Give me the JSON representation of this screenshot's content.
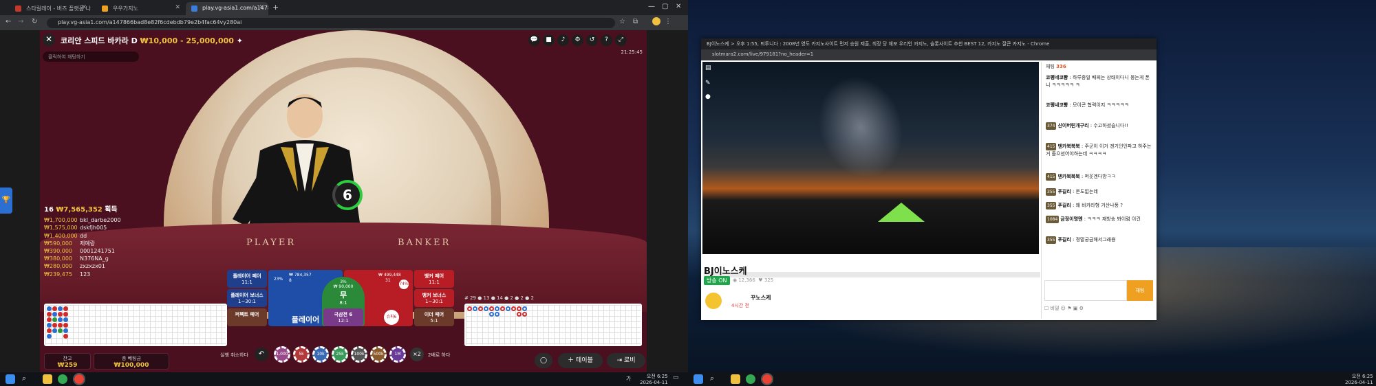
{
  "browser": {
    "tabs": [
      {
        "title": "스타릴레이 - 버즈 플랫폼 나디",
        "active": false,
        "color": "#c0392b"
      },
      {
        "title": "우우가지노",
        "active": false,
        "color": "#f0a020"
      },
      {
        "title": "play.vg-asia1.com/a1478",
        "active": true,
        "color": "#3b7ddd"
      }
    ],
    "new_tab": "+",
    "url": "play.vg-asia1.com/a147866bad8e82f6cdebdb79e2b4fac64vy280ai"
  },
  "game": {
    "close": "✕",
    "title": "코리안 스피드 바카라 D",
    "limit": "₩10,000 - 25,000,000",
    "chat_placeholder": "클릭하여 채팅하기",
    "clock": "21:25:45",
    "timer": "6",
    "table_player": "PLAYER",
    "table_banker": "BANKER",
    "players_count": "16",
    "players_total": "₩7,565,352",
    "players_total_suffix": "획득",
    "winners": [
      {
        "amount": "₩1,700,000",
        "name": "bkl_darbe2000"
      },
      {
        "amount": "₩1,575,000",
        "name": "dskfjh005"
      },
      {
        "amount": "₩1,400,000",
        "name": "dd"
      },
      {
        "amount": "₩590,000",
        "name": "제예랑"
      },
      {
        "amount": "₩390,000",
        "name": "0001241751"
      },
      {
        "amount": "₩380,000",
        "name": "N376NA_g"
      },
      {
        "amount": "₩280,000",
        "name": "zxzxzx01"
      },
      {
        "amount": "₩239,475",
        "name": "123"
      }
    ],
    "bets": {
      "player_pair": "플레이어 페어",
      "player_pair_odds": "11:1",
      "player_bonus": "플레이어 보너스",
      "player_bonus_odds": "1~30:1",
      "perfect_pair": "퍼펙트 페어",
      "player": "플레이어",
      "player_pct": "23%",
      "player_amt": "₩ 784,357",
      "player_count": "8",
      "tie": "무",
      "tie_odds": "8:1",
      "tie_pct": "3%",
      "tie_amt": "₩ 90,000",
      "banker_pct": "74%",
      "banker_amt": "₩ 499,448",
      "banker_count": "31",
      "banker_pair": "뱅커 페어",
      "banker_pair_odds": "11:1",
      "banker_bonus": "뱅커 보너스",
      "banker_bonus_odds": "1~30:1",
      "either_pair": "이더 페어",
      "either_pair_odds": "5:1",
      "super6": "슈퍼6",
      "lucky6": "극삼전 6",
      "lucky6_odds": "12:1"
    },
    "stats": "# 29  ● 13  ● 14  ● 2  ● 2  ● 2",
    "balance_label": "잔고",
    "balance": "₩259",
    "total_bet_label": "총 베팅금",
    "total_bet": "₩100,000",
    "undo_label": "실행 취소하다",
    "chips": [
      "1,000",
      "5k",
      "10k",
      "25k",
      "100k",
      "500k",
      "1M"
    ],
    "double": "×2",
    "double_label": "2배로 하다",
    "table_btn": "테이블",
    "lobby_btn": "로비"
  },
  "taskbar_left": {
    "time": "오전 6:25",
    "date": "2026-04-11",
    "lang": "가"
  },
  "stream": {
    "window_title": "BJ이노스케 > 오후 1:55, 퇴투니다 : 2008년 영도 카지노사이트 먼저 승원 제출, 최장 당 체포 우리언 카지노, 슬롯사이트 추천 BEST 12, 카지노 잘큰 카지노 - Chrome",
    "url": "slotmara2.com/live/979181?no_header=1",
    "streamer": "BJ이노스케",
    "on_air": "방송 ON",
    "viewers": "12,366",
    "fans": "325",
    "profile_name": "꾸노스케",
    "profile_time": "4시간 전",
    "chat_title": "채팅",
    "chat_count": "336",
    "messages": [
      {
        "user": "코펭네코빵",
        "text": "하루종일 배찌는 상태이다니 뭉는게 폰니 ㅋㅋㅋㅋㅋ ㅋ"
      },
      {
        "user": "코펭네코빵",
        "text": "모이콘 협력이지 ㅋㅋㅋㅋㅋ"
      },
      {
        "user": "신이버린개구리",
        "lv": "374",
        "text": "수고하셨습니다!!"
      },
      {
        "user": "덴카북북북",
        "lv": "415",
        "text": "주군이 이거 겐기인인파고 하주는거 돌으셨어야하는데 ㅋㅋㅋㅋ"
      },
      {
        "user": "덴카북북북",
        "lv": "415",
        "text": "퍼웃겐다방ㅋㅋ"
      },
      {
        "user": "푸길리",
        "lv": "355",
        "text": "돈도없는데"
      },
      {
        "user": "푸길리",
        "lv": "355",
        "text": "왜 바카라형 거산나풍 ?"
      },
      {
        "user": "금정이명뎬",
        "lv": "1084",
        "text": "ㅋㅋㅋ 재방송 봐이럼 이건"
      },
      {
        "user": "푸길리",
        "lv": "355",
        "text": "정말궁금해서그래용"
      }
    ],
    "send": "채팅",
    "tools": "비밀"
  },
  "taskbar_right": {
    "time": "오전 6:25",
    "date": "2026-04-11"
  }
}
